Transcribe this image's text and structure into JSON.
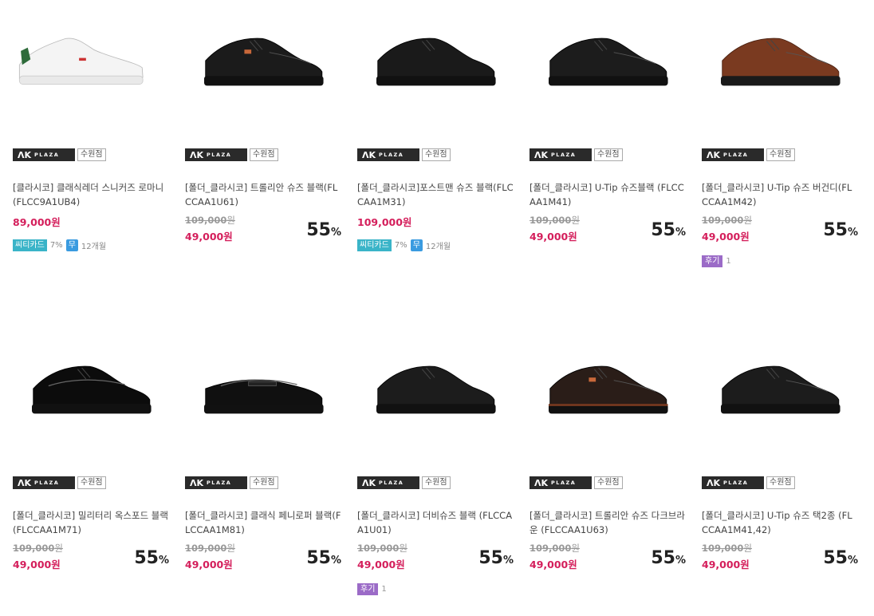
{
  "store": {
    "logo_text_ak": "ΛK",
    "logo_text_plaza": "PLAZA",
    "branch": "수원점"
  },
  "colors": {
    "price": "#d41e5b",
    "card_badge": "#3ab4c8",
    "free_badge": "#3a9be0",
    "review_badge": "#9b6bc7"
  },
  "products": [
    {
      "name": "[클라시코] 클래식레더 스니커즈 로마니(FLCC9A1UB4)",
      "old_price": "",
      "old_won": "",
      "price": "89,000원",
      "discount": "",
      "discount_pct": "",
      "card": "씨티카드",
      "card_rate": "7%",
      "free": "무",
      "months": "12개월",
      "review": "",
      "review_count": "",
      "shoe_icon": "white-sneaker-icon"
    },
    {
      "name": "[폴더_클라시코] 트롤리안 슈즈 블랙(FLCCAA1U61)",
      "old_price": "109,000",
      "old_won": "원",
      "price": "49,000원",
      "discount": "55",
      "discount_pct": "%",
      "card": "",
      "card_rate": "",
      "free": "",
      "months": "",
      "review": "",
      "review_count": "",
      "shoe_icon": "black-moc-toe-shoe-icon"
    },
    {
      "name": "[폴더_클라시코]포스트맨 슈즈 블랙(FLCCAA1M31)",
      "old_price": "",
      "old_won": "",
      "price": "109,000원",
      "discount": "",
      "discount_pct": "",
      "card": "씨티카드",
      "card_rate": "7%",
      "free": "무",
      "months": "12개월",
      "review": "",
      "review_count": "",
      "shoe_icon": "black-derby-shoe-icon"
    },
    {
      "name": "[폴더_클라시코] U-Tip 슈즈블랙 (FLCCAA1M41)",
      "old_price": "109,000",
      "old_won": "원",
      "price": "49,000원",
      "discount": "55",
      "discount_pct": "%",
      "card": "",
      "card_rate": "",
      "free": "",
      "months": "",
      "review": "",
      "review_count": "",
      "shoe_icon": "black-utip-shoe-icon"
    },
    {
      "name": "[폴더_클라시코] U-Tip 슈즈 버건디(FLCCAA1M42)",
      "old_price": "109,000",
      "old_won": "원",
      "price": "49,000원",
      "discount": "55",
      "discount_pct": "%",
      "card": "",
      "card_rate": "",
      "free": "",
      "months": "",
      "review": "후기",
      "review_count": "1",
      "shoe_icon": "brown-utip-shoe-icon"
    },
    {
      "name": "[폴더_클라시코] 밀리터리 옥스포드 블랙 (FLCCAA1M71)",
      "old_price": "109,000",
      "old_won": "원",
      "price": "49,000원",
      "discount": "55",
      "discount_pct": "%",
      "card": "",
      "card_rate": "",
      "free": "",
      "months": "",
      "review": "",
      "review_count": "",
      "shoe_icon": "patent-oxford-shoe-icon"
    },
    {
      "name": "[폴더_클라시코] 클래식 페니로퍼 블랙(FLCCAA1M81)",
      "old_price": "109,000",
      "old_won": "원",
      "price": "49,000원",
      "discount": "55",
      "discount_pct": "%",
      "card": "",
      "card_rate": "",
      "free": "",
      "months": "",
      "review": "",
      "review_count": "",
      "shoe_icon": "penny-loafer-icon"
    },
    {
      "name": "[폴더_클라시코] 더비슈즈 블랙 (FLCCAA1U01)",
      "old_price": "109,000",
      "old_won": "원",
      "price": "49,000원",
      "discount": "55",
      "discount_pct": "%",
      "card": "",
      "card_rate": "",
      "free": "",
      "months": "",
      "review": "후기",
      "review_count": "1",
      "shoe_icon": "black-derby-shoe-icon"
    },
    {
      "name": "[폴더_클라시코] 트롤리안 슈즈 다크브라운 (FLCCAA1U63)",
      "old_price": "109,000",
      "old_won": "원",
      "price": "49,000원",
      "discount": "55",
      "discount_pct": "%",
      "card": "",
      "card_rate": "",
      "free": "",
      "months": "",
      "review": "",
      "review_count": "",
      "shoe_icon": "dark-brown-moc-toe-shoe-icon"
    },
    {
      "name": "[폴더_클라시코] U-Tip 슈즈 택2종 (FLCCAA1M41,42)",
      "old_price": "109,000",
      "old_won": "원",
      "price": "49,000원",
      "discount": "55",
      "discount_pct": "%",
      "card": "",
      "card_rate": "",
      "free": "",
      "months": "",
      "review": "",
      "review_count": "",
      "shoe_icon": "black-utip-shoe-icon"
    }
  ]
}
